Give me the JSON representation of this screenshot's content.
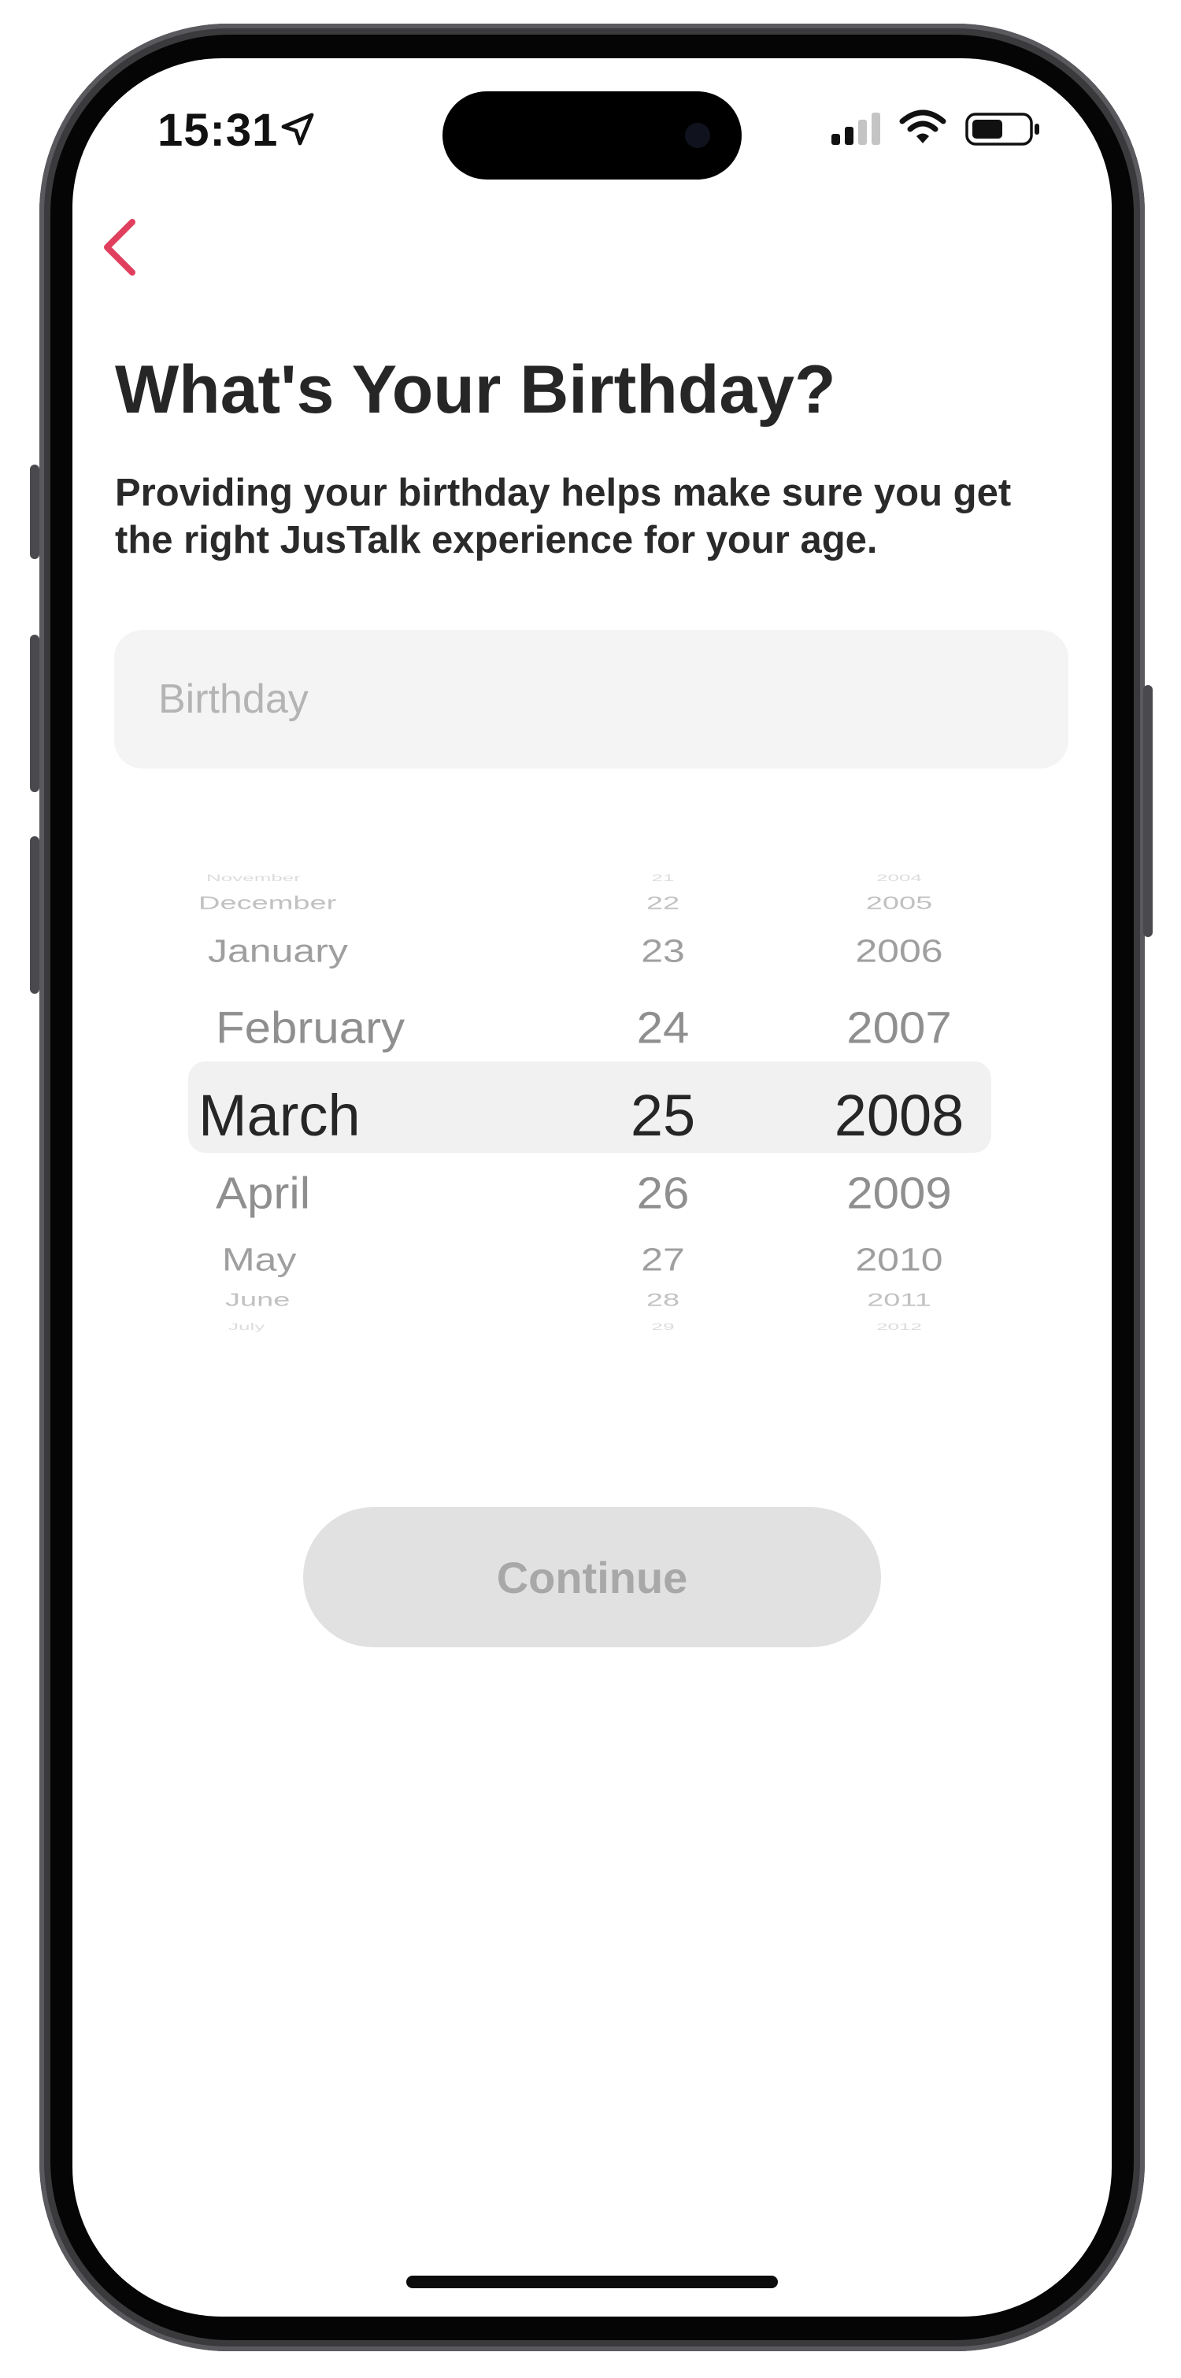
{
  "status_bar": {
    "time": "15:31",
    "icons": [
      "location-arrow-icon",
      "cellular-signal-icon",
      "wifi-icon",
      "battery-icon"
    ]
  },
  "navigation": {
    "back_icon": "chevron-left-icon"
  },
  "header": {
    "title": "What's Your Birthday?",
    "subtitle": "Providing your birthday helps make sure you get the right JusTalk experience for your age."
  },
  "birthday_field": {
    "placeholder": "Birthday",
    "value": ""
  },
  "picker": {
    "months": [
      "November",
      "December",
      "January",
      "February",
      "March",
      "April",
      "May",
      "June",
      "July"
    ],
    "days": [
      "21",
      "22",
      "23",
      "24",
      "25",
      "26",
      "27",
      "28",
      "29"
    ],
    "years": [
      "2004",
      "2005",
      "2006",
      "2007",
      "2008",
      "2009",
      "2010",
      "2011",
      "2012"
    ],
    "selected": {
      "month": "March",
      "day": "25",
      "year": "2008"
    }
  },
  "actions": {
    "continue_label": "Continue",
    "continue_enabled": false
  },
  "colors": {
    "accent": "#e0405e",
    "title_text": "#262626",
    "field_background": "#f4f4f4",
    "picker_highlight": "#f1f1f1",
    "disabled_button": "#e1e1e1",
    "disabled_button_text": "#a8a8a8"
  }
}
